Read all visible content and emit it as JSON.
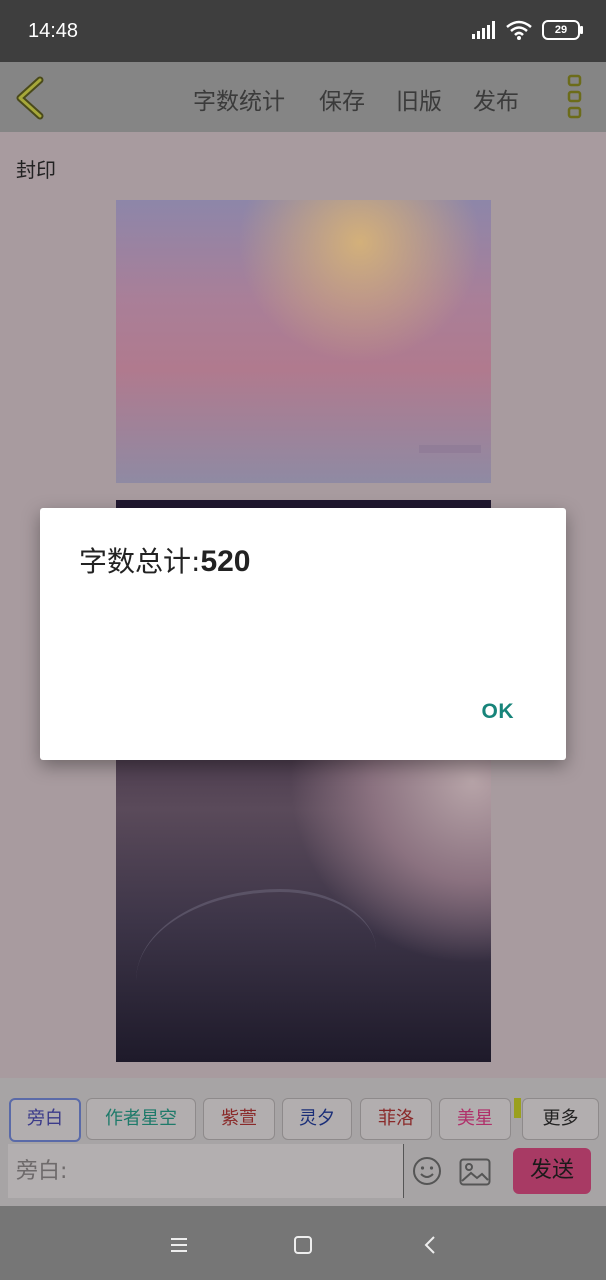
{
  "status_bar": {
    "time": "14:48",
    "battery": "29"
  },
  "toolbar": {
    "word_count_label": "字数统计",
    "save_label": "保存",
    "old_version_label": "旧版",
    "publish_label": "发布"
  },
  "content": {
    "seal_label": "封印"
  },
  "chips": [
    {
      "label": "旁白",
      "color": "#3b3b8a"
    },
    {
      "label": "作者星空",
      "color": "#1e7a6a"
    },
    {
      "label": "紫萱",
      "color": "#8a2a2a"
    },
    {
      "label": "灵夕",
      "color": "#1a2e78"
    },
    {
      "label": "菲洛",
      "color": "#8a2a2a"
    },
    {
      "label": "美星",
      "color": "#b0306a"
    },
    {
      "label": "更多",
      "color": "#222222"
    }
  ],
  "input": {
    "placeholder": "旁白:"
  },
  "send_label": "发送",
  "dialog": {
    "message_prefix": "字数总计:",
    "count": "520",
    "ok_label": "OK"
  }
}
